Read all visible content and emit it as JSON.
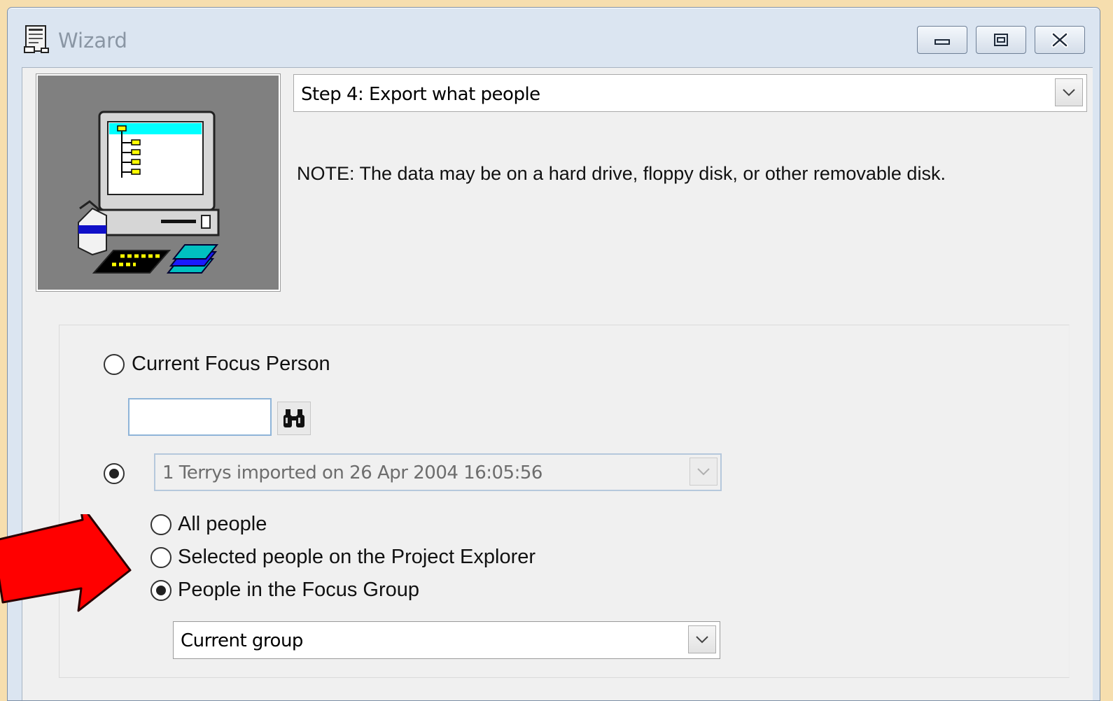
{
  "window": {
    "title": "Wizard",
    "controls": {
      "minimize": "minimize-icon",
      "maximize": "maximize-icon",
      "close": "close-icon"
    }
  },
  "wizard": {
    "step_select": {
      "value": "Step 4: Export what people"
    },
    "note": "NOTE: The data may be on a hard drive, floppy disk, or other removable disk."
  },
  "options": {
    "current_focus_person": {
      "label": "Current Focus Person",
      "checked": false
    },
    "focus_person_input": {
      "value": ""
    },
    "import_source": {
      "checked": true,
      "value": "1 Terrys imported on 26 Apr 2004 16:05:56"
    },
    "all_people": {
      "label": "All people",
      "checked": false
    },
    "selected_people": {
      "label": "Selected people on the Project Explorer",
      "checked": false
    },
    "focus_group_people": {
      "label": "People in the Focus Group",
      "checked": true
    },
    "group_select": {
      "value": "Current group"
    }
  },
  "annotation": {
    "arrow_color": "#ff0000"
  }
}
